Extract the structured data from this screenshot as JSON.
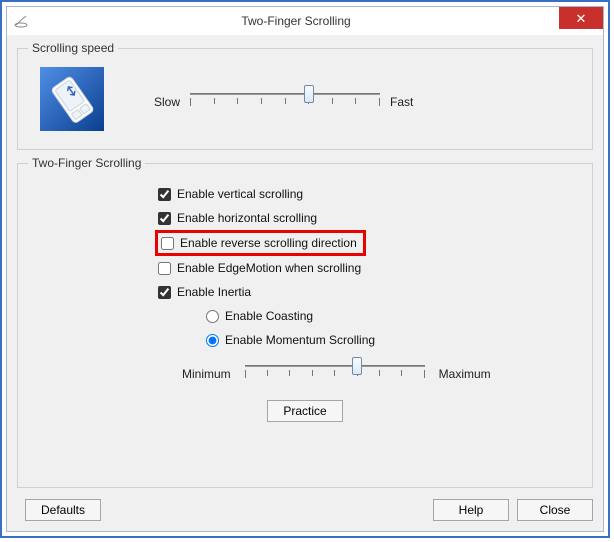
{
  "window": {
    "title": "Two-Finger Scrolling",
    "close_glyph": "✕"
  },
  "groups": {
    "speed": {
      "legend": "Scrolling speed",
      "slow_label": "Slow",
      "fast_label": "Fast",
      "ticks": 9,
      "value_index": 5
    },
    "tfs": {
      "legend": "Two-Finger Scrolling",
      "options": {
        "vert": {
          "label": "Enable vertical scrolling",
          "checked": true
        },
        "horiz": {
          "label": "Enable horizontal scrolling",
          "checked": true
        },
        "reverse": {
          "label": "Enable reverse scrolling direction",
          "checked": false
        },
        "edge": {
          "label": "Enable EdgeMotion when scrolling",
          "checked": false
        },
        "inertia": {
          "label": "Enable Inertia",
          "checked": true
        }
      },
      "inertia_mode": {
        "coasting": {
          "label": "Enable Coasting",
          "selected": false
        },
        "momentum": {
          "label": "Enable Momentum Scrolling",
          "selected": true
        }
      },
      "inertia_slider": {
        "min_label": "Minimum",
        "max_label": "Maximum",
        "ticks": 9,
        "value_index": 5
      },
      "practice_label": "Practice"
    }
  },
  "footer": {
    "defaults": "Defaults",
    "help": "Help",
    "close": "Close"
  }
}
